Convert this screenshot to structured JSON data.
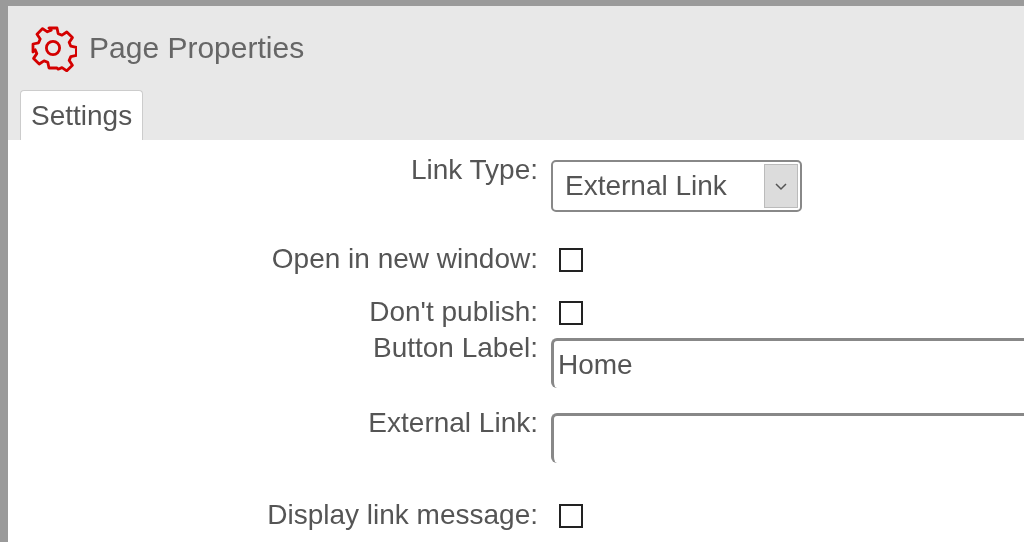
{
  "window": {
    "title": "Page Properties"
  },
  "tabs": [
    {
      "label": "Settings",
      "selected": true
    }
  ],
  "fields": [
    {
      "kind": "select",
      "label": "Link Type:",
      "value": "External Link"
    },
    {
      "kind": "checkbox",
      "label": "Open in new window:",
      "checked": false
    },
    {
      "kind": "checkbox",
      "label": "Don't publish:",
      "checked": false
    },
    {
      "kind": "text",
      "label": "Button Label:",
      "value": "Home"
    },
    {
      "kind": "text",
      "label": "External Link:"
    },
    {
      "kind": "checkbox",
      "label": "Display link message:",
      "checked": false
    }
  ]
}
